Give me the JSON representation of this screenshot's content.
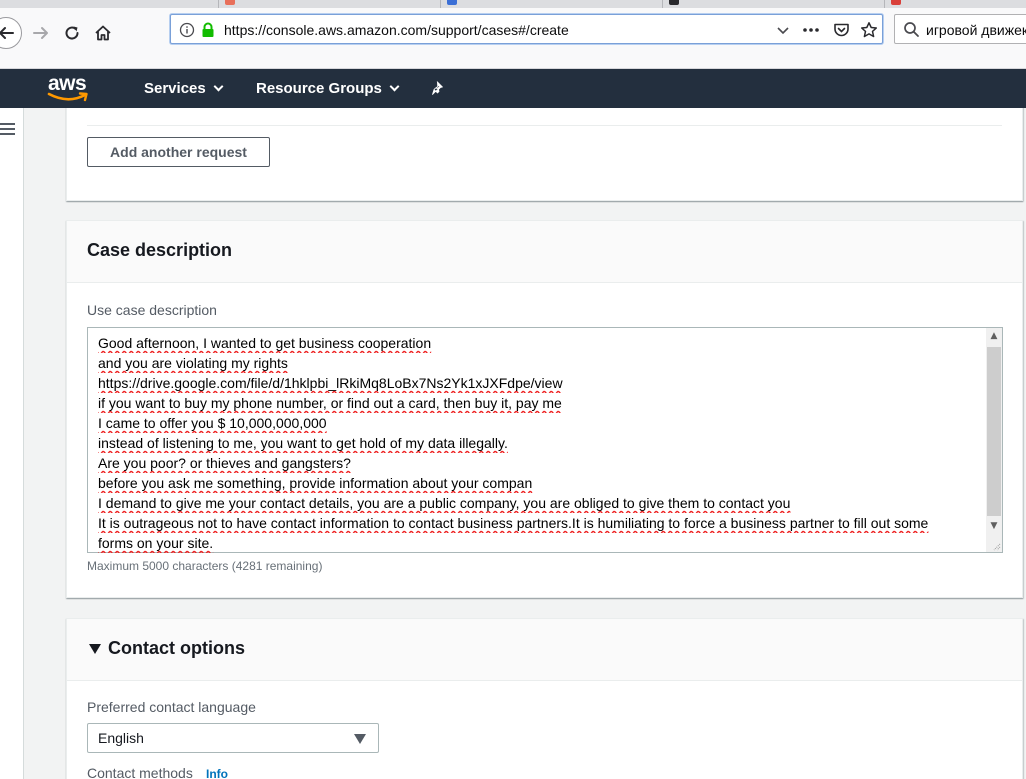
{
  "browser": {
    "url": "https://console.aws.amazon.com/support/cases#/create",
    "search_text": "игровой движек"
  },
  "aws_nav": {
    "logo_text": "aws",
    "menus": [
      {
        "label": "Services"
      },
      {
        "label": "Resource Groups"
      }
    ]
  },
  "request_section": {
    "add_button_label": "Add another request"
  },
  "case_description": {
    "title": "Case description",
    "field_label": "Use case description",
    "lines": [
      "Good afternoon, I wanted to get business cooperation",
      "and you are violating my rights",
      "https://drive.google.com/file/d/1hklpbi_lRkiMq8LoBx7Ns2Yk1xJXFdpe/view",
      "if you want to buy my phone number, or find out a card, then buy it, pay me",
      "I came to offer you $ 10,000,000,000",
      "instead of listening to me, you want to get hold of my data illegally.",
      "Are you poor? or thieves and gangsters?",
      "before you ask me something, provide information about your compan",
      "I demand to give me your contact details, you are a public company, you are obliged to give them to contact you",
      "It is outrageous not to have contact information to contact business partners.It is humiliating to force a business partner to fill out some",
      "forms on your site."
    ],
    "help_text": "Maximum 5000 characters (4281 remaining)"
  },
  "contact_options": {
    "title": "Contact options",
    "language_label": "Preferred contact language",
    "language_value": "English",
    "methods_label": "Contact methods",
    "methods_info": "Info"
  },
  "colors": {
    "aws_nav_bg": "#232f3e",
    "aws_orange": "#ff9900",
    "content_bg": "#f2f3f3",
    "link_blue": "#0073bb",
    "secure_green": "#12bc00"
  }
}
